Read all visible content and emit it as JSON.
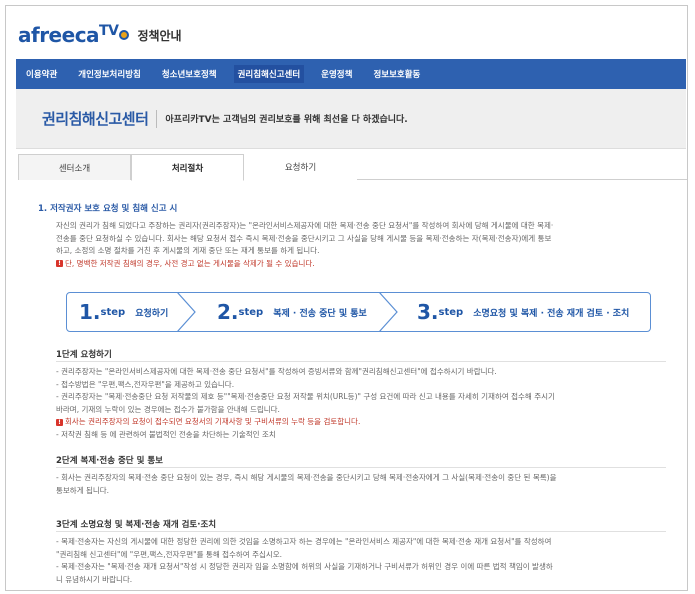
{
  "logo": {
    "brand": "afreeca",
    "brand_tv": "TV",
    "section": "정책안내"
  },
  "nav": {
    "items": [
      {
        "label": "이용약관"
      },
      {
        "label": "개인정보처리방침"
      },
      {
        "label": "청소년보호정책"
      },
      {
        "label": "권리침해신고센터"
      },
      {
        "label": "운영정책"
      },
      {
        "label": "정보보호활동"
      }
    ],
    "active_index": 3
  },
  "banner": {
    "title": "권리침해신고센터",
    "description": "아프리카TV는 고객님의 권리보호를 위해 최선을 다 하겠습니다."
  },
  "tabs": [
    {
      "label": "센터소개"
    },
    {
      "label": "처리절차"
    },
    {
      "label": "요청하기"
    }
  ],
  "content": {
    "section_title": "1. 저작권자 보호 요청 및 침해 신고 시",
    "intro_lines": [
      "자신의 권리가 침해 되었다고 주장하는 권리자(권리주장자)는 \"온라인서비스제공자에 대한 복제·전송 중단 요청서\"를 작성하여 회사에 당해 게시물에 대한 복제·",
      "전송를 중단 요청하실 수 있습니다. 회사는 해당 요청서 접수 즉시 복제·전송을 중단시키고 그 사실을 당해 게시물 등을 복제·전송하는 자(복제·전송자)에게 통보",
      "하고, 소정의 소명 절차를 거친 후 게시물의 게재 중단 또는 재게 통보를 하게 됩니다."
    ],
    "intro_warning": "단, 명백한 저작권 침해의 경우, 사전 경고 없는 게시물을 삭제가 될 수 있습니다.",
    "steps": [
      {
        "num": "1.",
        "word": "step",
        "label": "요청하기"
      },
      {
        "num": "2.",
        "word": "step",
        "label": "복제 · 전송 중단 및 통보"
      },
      {
        "num": "3.",
        "word": "step",
        "label": "소명요청 및 복제 · 전송 재개 검토 · 조치"
      }
    ],
    "step1": {
      "title": "1단계 요청하기",
      "lines": [
        "- 권리주장자는 \"온라인서비스제공자에 대한 복제·전송 중단 요청서\"를 작성하여 증빙서류와 함께\"권리침해신고센터\"에 접수하시기 바랍니다.",
        "- 접수방법은 \"우편,팩스,전자우편\"을 제공하고 있습니다.",
        "- 권리주장자는 \"복제·전송중단 요청 저작물의 제호 등\"\"복제·전송중단 요청 저작물 위치(URL등)\" 구성 요건에 따라 신고 내용를 자세히 기재하여 접수해 주시기",
        "바라며, 기재의 누락이 있는 경우에는 접수가 불가함을 안내해 드립니다."
      ],
      "warning": "회사는 권리주장자의 요청이 접수되면 요청서의 기재사항 및 구비서류의 누락 등을 검토합니다.",
      "last_line": "- 저작권 침해 등 에 관련하여 불법적인 전송을 차단하는 기술적인 조치"
    },
    "step2": {
      "title": "2단계 복제·전송 중단 및 통보",
      "lines": [
        "- 회사는 권리주장자의 복제·전송 중단 요청이 있는 경우, 즉시 해당 게시물의 복제·전송을 중단시키고 당해 복제·전송자에게 그 사실(복제·전송이 중단 된 목록)을",
        "통보하게 됩니다."
      ]
    },
    "step3": {
      "title": "3단계 소명요청 및 복제·전송 재개 검토·조치",
      "lines": [
        "- 복제·전송자는 자신의 게시물에 대한 정당한 권리에 의한 것임을 소명하고자 하는 경우에는 \"온라인서비스 제공자\"에 대한 복제·전송 재개 요청서\"를 작성하여",
        "\"권리침해 신고센터\"에 \"우편,팩스,전자우편\"를 통해 접수하여 주십시오.",
        "- 복제·전송자는 \"복제·전송 재개 요청서\"작성 시 정당한 권리자 임을 소명함에 허위의 사실을 기재하거나 구비서류가 허위인 경우 이에 따른 법적 책임이 발생하",
        "니 유념하시기 바랍니다."
      ]
    }
  },
  "colors": {
    "brand_blue": "#2e61b0",
    "title_blue": "#2a5aa6",
    "warning_red": "#c0392b"
  }
}
